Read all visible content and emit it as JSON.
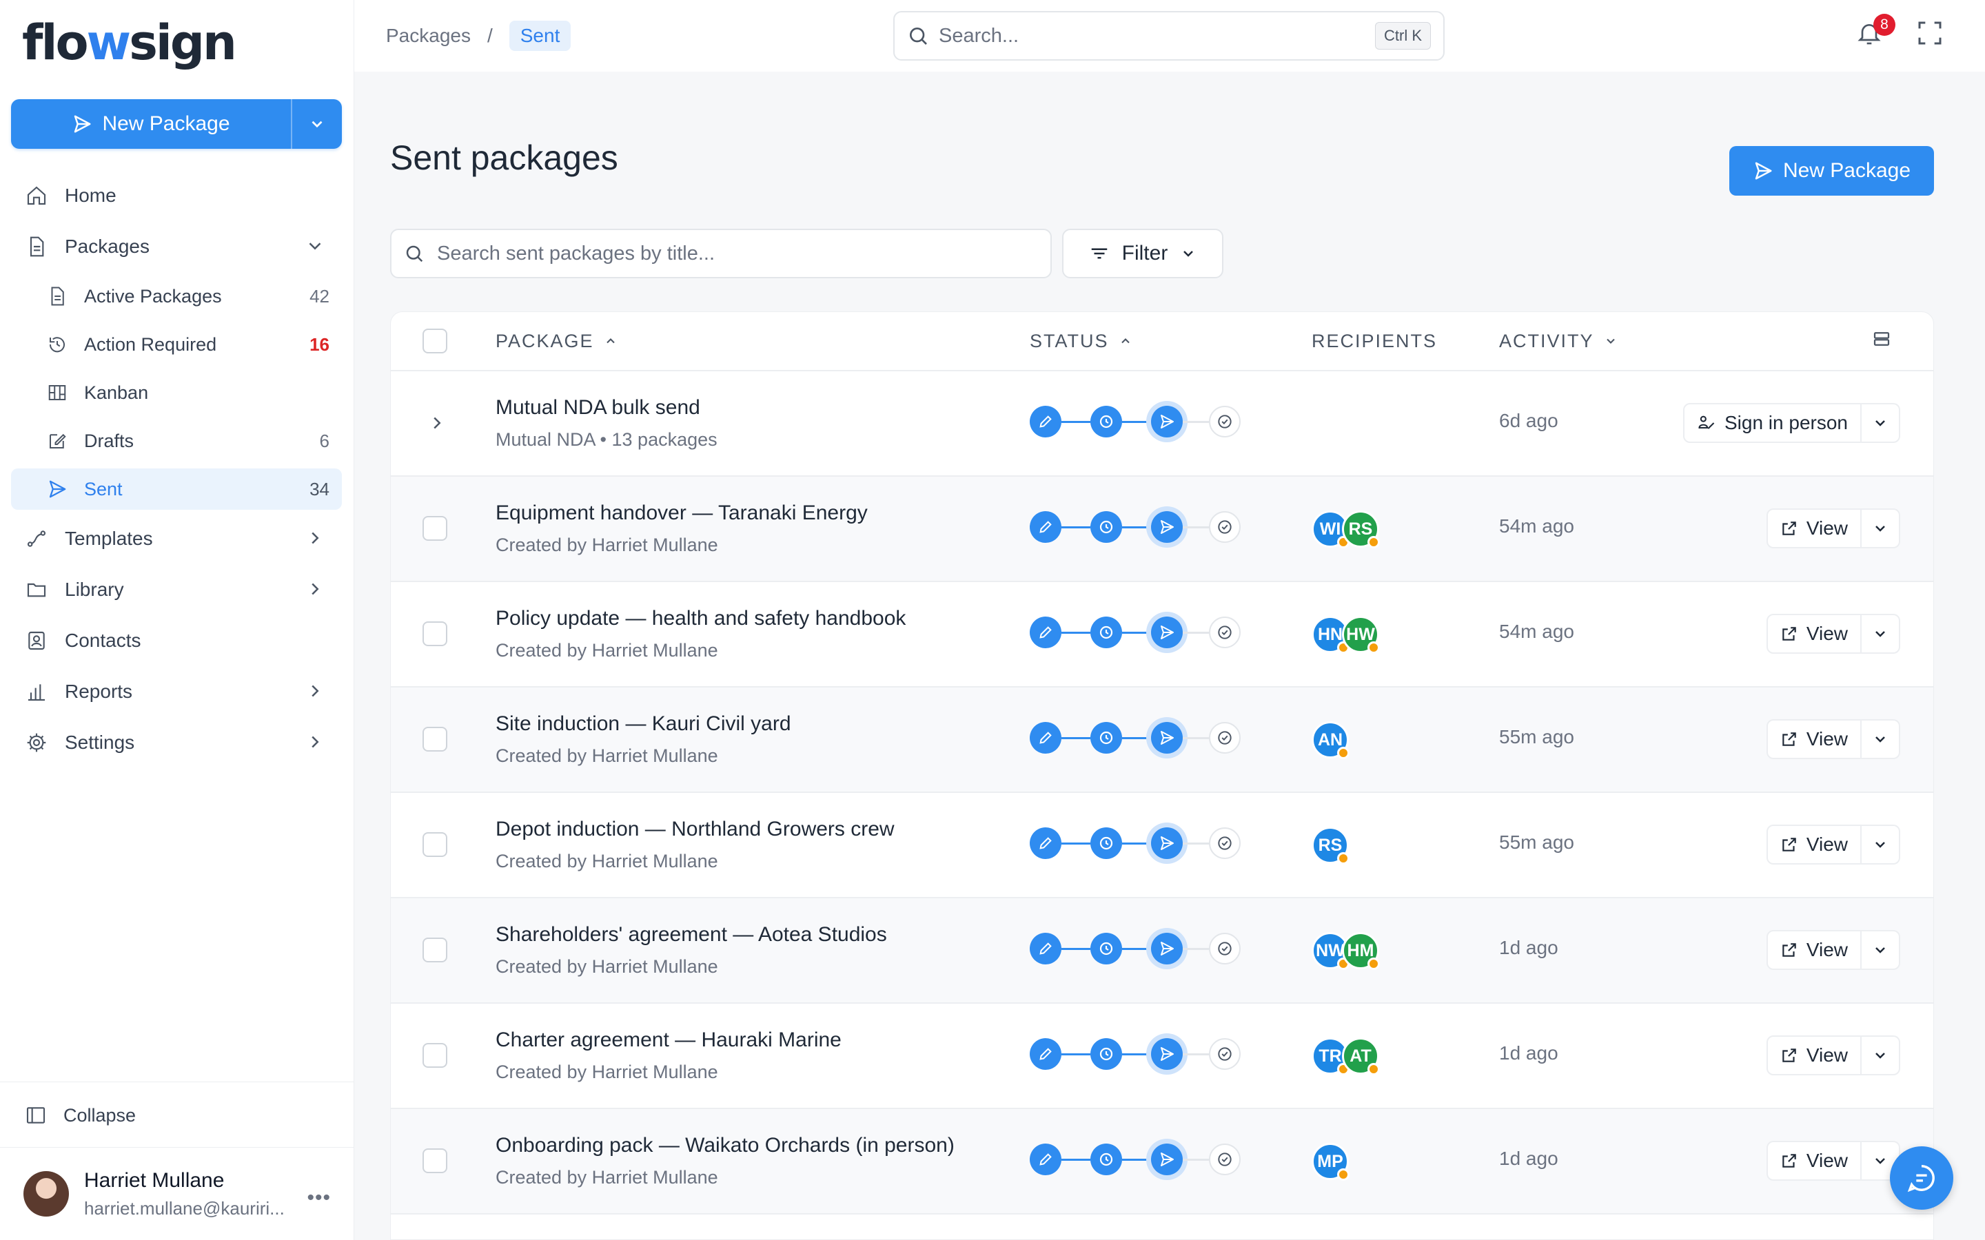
{
  "brand": {
    "part1": "flo",
    "part2": "w",
    "part3": "sign"
  },
  "sidebar": {
    "new_package_label": "New Package",
    "items": [
      {
        "label": "Home"
      },
      {
        "label": "Packages"
      },
      {
        "label": "Active Packages",
        "count": "42"
      },
      {
        "label": "Action Required",
        "count": "16"
      },
      {
        "label": "Kanban"
      },
      {
        "label": "Drafts",
        "count": "6"
      },
      {
        "label": "Sent",
        "count": "34"
      },
      {
        "label": "Templates"
      },
      {
        "label": "Library"
      },
      {
        "label": "Contacts"
      },
      {
        "label": "Reports"
      },
      {
        "label": "Settings"
      }
    ],
    "collapse_label": "Collapse",
    "user": {
      "name": "Harriet Mullane",
      "email": "harriet.mullane@kauriri..."
    }
  },
  "topbar": {
    "breadcrumb": [
      "Packages",
      "/",
      "Sent"
    ],
    "search_placeholder": "Search...",
    "shortcut": "Ctrl K",
    "notification_count": "8"
  },
  "main": {
    "title": "Sent packages",
    "new_package_label": "New Package",
    "search_placeholder": "Search sent packages by title...",
    "filter_label": "Filter",
    "columns": [
      "PACKAGE",
      "STATUS",
      "RECIPIENTS",
      "ACTIVITY"
    ],
    "rows": [
      {
        "title": "Mutual NDA bulk send",
        "sub": "Mutual NDA • 13 packages",
        "recipients": [],
        "activity": "6d ago",
        "action": "Sign in person"
      },
      {
        "title": "Equipment handover — Taranaki Energy",
        "sub": "Created by Harriet Mullane",
        "recipients": [
          "WI",
          "RS"
        ],
        "activity": "54m ago",
        "action": "View"
      },
      {
        "title": "Policy update — health and safety handbook",
        "sub": "Created by Harriet Mullane",
        "recipients": [
          "HN",
          "HW"
        ],
        "activity": "54m ago",
        "action": "View"
      },
      {
        "title": "Site induction — Kauri Civil yard",
        "sub": "Created by Harriet Mullane",
        "recipients": [
          "AN"
        ],
        "activity": "55m ago",
        "action": "View"
      },
      {
        "title": "Depot induction — Northland Growers crew",
        "sub": "Created by Harriet Mullane",
        "recipients": [
          "RS"
        ],
        "activity": "55m ago",
        "action": "View"
      },
      {
        "title": "Shareholders' agreement — Aotea Studios",
        "sub": "Created by Harriet Mullane",
        "recipients": [
          "NW",
          "HM"
        ],
        "activity": "1d ago",
        "action": "View"
      },
      {
        "title": "Charter agreement — Hauraki Marine",
        "sub": "Created by Harriet Mullane",
        "recipients": [
          "TR",
          "AT"
        ],
        "activity": "1d ago",
        "action": "View"
      },
      {
        "title": "Onboarding pack — Waikato Orchards (in person)",
        "sub": "Created by Harriet Mullane",
        "recipients": [
          "MP"
        ],
        "activity": "1d ago",
        "action": "View"
      }
    ]
  },
  "colors": {
    "accent": "#2f8cf0",
    "danger": "#dc2626",
    "avatar_blue": "#1e88e5",
    "avatar_green": "#22a04b",
    "dot_orange": "#f59e0b"
  }
}
